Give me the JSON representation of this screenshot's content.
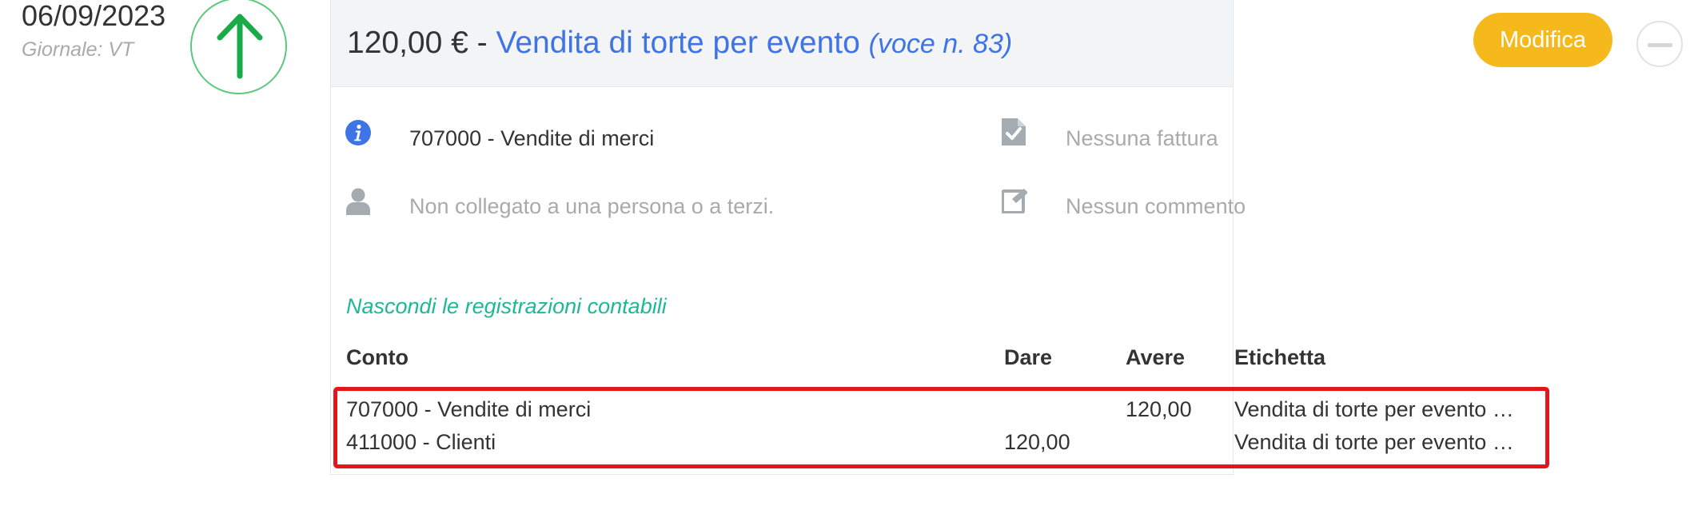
{
  "left": {
    "date": "06/09/2023",
    "journal": "Giornale: VT",
    "direction_icon": "arrow-up-icon"
  },
  "header": {
    "amount": "120,00 €",
    "separator": "-",
    "title": "Vendita di torte per evento",
    "entry_number": "(voce n. 83)",
    "edit_label": "Modifica",
    "collapse_icon": "minus-icon"
  },
  "details": {
    "account": {
      "icon": "info-icon",
      "text": "707000 - Vendite di merci"
    },
    "invoice": {
      "icon": "document-check-icon",
      "text": "Nessuna fattura"
    },
    "person": {
      "icon": "user-icon",
      "text": "Non collegato a una persona o a terzi."
    },
    "comment": {
      "icon": "edit-note-icon",
      "text": "Nessun commento"
    }
  },
  "toggle_link": "Nascondi le registrazioni contabili",
  "table": {
    "headers": {
      "conto": "Conto",
      "dare": "Dare",
      "avere": "Avere",
      "etichetta": "Etichetta"
    },
    "rows": [
      {
        "conto": "707000 - Vendite di merci",
        "dare": "",
        "avere": "120,00",
        "etichetta": "Vendita di torte per evento …"
      },
      {
        "conto": "411000 - Clienti",
        "dare": "120,00",
        "avere": "",
        "etichetta": "Vendita di torte per evento …"
      }
    ]
  },
  "colors": {
    "accent_blue": "#3f74e5",
    "button_yellow": "#f5b91c",
    "link_green": "#1db997",
    "arrow_green": "#1aaa4a",
    "highlight_red": "#e3161a"
  }
}
